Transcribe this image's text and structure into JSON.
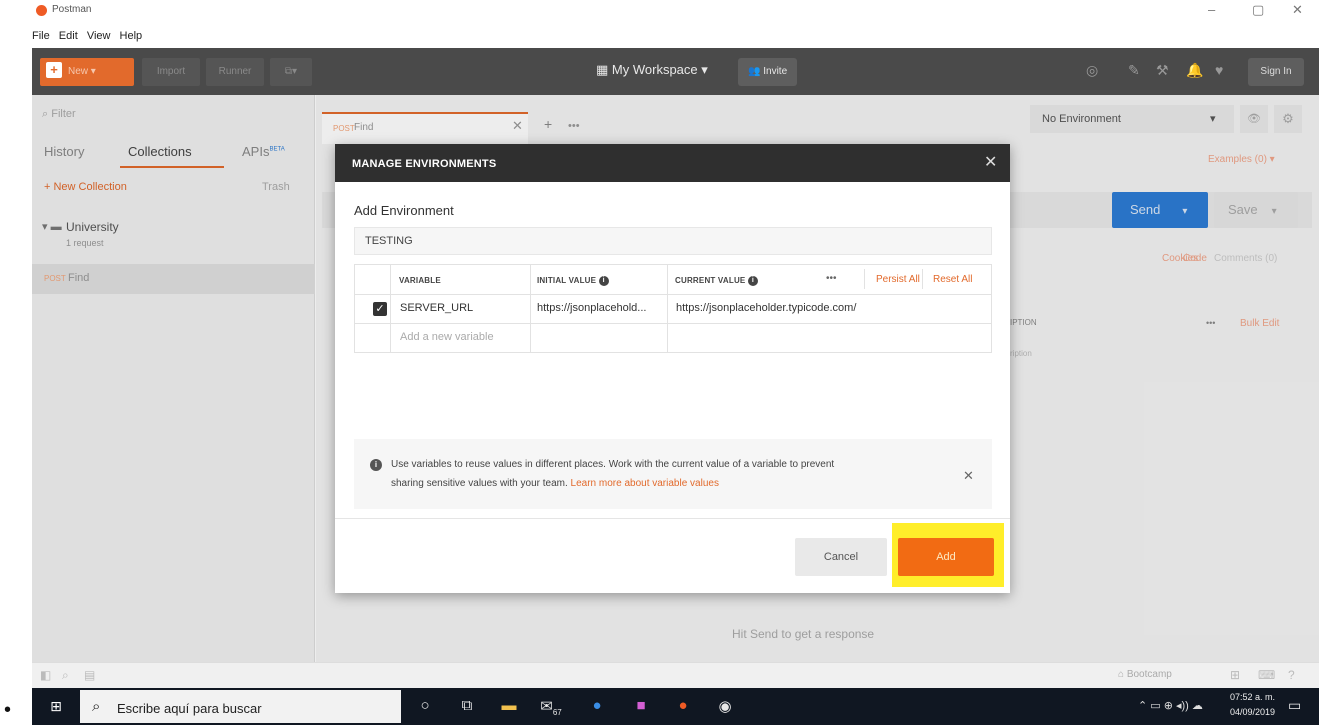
{
  "window": {
    "title": "Postman",
    "controls": {
      "minimize": "–",
      "maximize": "▢",
      "close": "✕"
    }
  },
  "menu": [
    "File",
    "Edit",
    "View",
    "Help"
  ],
  "header": {
    "new_label": "New",
    "import_label": "Import",
    "runner_label": "Runner",
    "workspace_label": "My Workspace",
    "invite_label": "Invite",
    "signin_label": "Sign In"
  },
  "sidebar": {
    "filter_placeholder": "Filter",
    "tabs": {
      "history": "History",
      "collections": "Collections",
      "apis": "APIs",
      "apis_badge": "BETA"
    },
    "new_collection": "+ New Collection",
    "trash": "Trash",
    "collection": {
      "name": "University",
      "count": "1 request"
    },
    "request": {
      "method": "POST",
      "name": "Find"
    }
  },
  "main": {
    "tab": {
      "method": "POST",
      "name": "Find"
    },
    "environment": "No Environment",
    "examples": "Examples (0)",
    "send": "Send",
    "save": "Save",
    "cookies": "Cookies",
    "code": "Code",
    "comments": "Comments (0)",
    "description_col": "IPTION",
    "bulk_edit": "Bulk Edit",
    "description_ph": "ription",
    "hit_send": "Hit Send to get a response"
  },
  "statusbar": {
    "bootcamp": "Bootcamp"
  },
  "modal": {
    "title": "MANAGE ENVIRONMENTS",
    "add_env_label": "Add Environment",
    "env_name": "TESTING",
    "columns": {
      "variable": "VARIABLE",
      "initial": "INITIAL VALUE",
      "current": "CURRENT VALUE",
      "persist_all": "Persist All",
      "reset_all": "Reset All"
    },
    "rows": [
      {
        "checked": true,
        "variable": "SERVER_URL",
        "initial": "https://jsonplacehold...",
        "current": "https://jsonplaceholder.typicode.com/"
      }
    ],
    "add_placeholder": "Add a new variable",
    "help_line1": "Use variables to reuse values in different places. Work with the current value of a variable to prevent",
    "help_line2_prefix": "sharing sensitive values with your team. ",
    "help_link": "Learn more about variable values",
    "cancel": "Cancel",
    "add": "Add"
  },
  "taskbar": {
    "search_placeholder": "Escribe aquí para buscar",
    "badge_count": "67",
    "time": "07:52 a. m.",
    "date": "04/09/2019"
  },
  "colors": {
    "accent": "#e26a2c",
    "send": "#2d7cd6",
    "highlight": "#ffee2a",
    "add_button": "#f26b13"
  }
}
